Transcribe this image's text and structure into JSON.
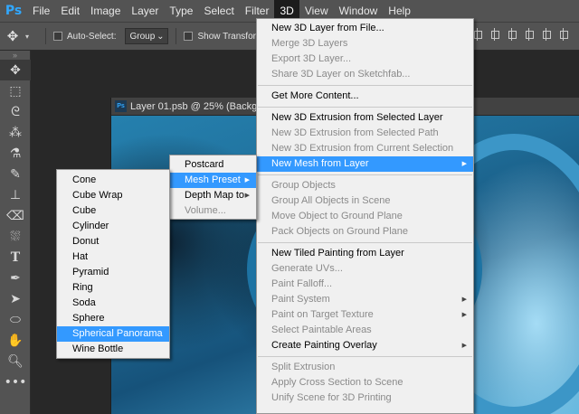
{
  "app": {
    "logo": "Ps",
    "menus": [
      "File",
      "Edit",
      "Image",
      "Layer",
      "Type",
      "Select",
      "Filter",
      "3D",
      "View",
      "Window",
      "Help"
    ],
    "active_menu": "3D"
  },
  "options_bar": {
    "move_icon": "move-icon",
    "auto_select_label": "Auto-Select:",
    "auto_select_value": "Group",
    "show_transform_label": "Show Transform"
  },
  "tools": [
    "move-tool",
    "marquee-tool",
    "lasso-tool",
    "magic-wand-tool",
    "eyedropper-tool",
    "brush-tool",
    "stamp-tool",
    "eraser-tool",
    "paint-bucket-tool",
    "type-tool",
    "pen-tool",
    "path-select-tool",
    "shape-tool",
    "hand-tool",
    "zoom-tool",
    "more-tools"
  ],
  "document": {
    "title": "Layer 01.psb @ 25% (Backgro"
  },
  "menu_3d": {
    "items": [
      {
        "label": "New 3D Layer from File...",
        "enabled": true
      },
      {
        "label": "Merge 3D Layers",
        "enabled": false
      },
      {
        "label": "Export 3D Layer...",
        "enabled": false
      },
      {
        "label": "Share 3D Layer on Sketchfab...",
        "enabled": false
      },
      {
        "separator": true
      },
      {
        "label": "Get More Content...",
        "enabled": true
      },
      {
        "separator": true
      },
      {
        "label": "New 3D Extrusion from Selected Layer",
        "enabled": true
      },
      {
        "label": "New 3D Extrusion from Selected Path",
        "enabled": false
      },
      {
        "label": "New 3D Extrusion from Current Selection",
        "enabled": false
      },
      {
        "label": "New Mesh from Layer",
        "enabled": true,
        "submenu": true,
        "highlighted": true
      },
      {
        "separator": true
      },
      {
        "label": "Group Objects",
        "enabled": false
      },
      {
        "label": "Group All Objects in Scene",
        "enabled": false
      },
      {
        "label": "Move Object to Ground Plane",
        "enabled": false
      },
      {
        "label": "Pack Objects on Ground Plane",
        "enabled": false
      },
      {
        "separator": true
      },
      {
        "label": "New Tiled Painting from Layer",
        "enabled": true
      },
      {
        "label": "Generate UVs...",
        "enabled": false
      },
      {
        "label": "Paint Falloff...",
        "enabled": false
      },
      {
        "label": "Paint System",
        "enabled": false,
        "submenu": true
      },
      {
        "label": "Paint on Target Texture",
        "enabled": false,
        "submenu": true
      },
      {
        "label": "Select Paintable Areas",
        "enabled": false
      },
      {
        "label": "Create Painting Overlay",
        "enabled": true,
        "submenu": true
      },
      {
        "separator": true
      },
      {
        "label": "Split Extrusion",
        "enabled": false
      },
      {
        "label": "Apply Cross Section to Scene",
        "enabled": false
      },
      {
        "label": "Unify Scene for 3D Printing",
        "enabled": false
      }
    ]
  },
  "menu_new_mesh": {
    "items": [
      {
        "label": "Postcard",
        "enabled": true
      },
      {
        "label": "Mesh Preset",
        "enabled": true,
        "submenu": true,
        "highlighted": true
      },
      {
        "label": "Depth Map to",
        "enabled": true,
        "submenu": true
      },
      {
        "label": "Volume...",
        "enabled": false
      }
    ]
  },
  "menu_mesh_preset": {
    "items": [
      {
        "label": "Cone",
        "enabled": true
      },
      {
        "label": "Cube Wrap",
        "enabled": true
      },
      {
        "label": "Cube",
        "enabled": true
      },
      {
        "label": "Cylinder",
        "enabled": true
      },
      {
        "label": "Donut",
        "enabled": true
      },
      {
        "label": "Hat",
        "enabled": true
      },
      {
        "label": "Pyramid",
        "enabled": true
      },
      {
        "label": "Ring",
        "enabled": true
      },
      {
        "label": "Soda",
        "enabled": true
      },
      {
        "label": "Sphere",
        "enabled": true
      },
      {
        "label": "Spherical Panorama",
        "enabled": true,
        "highlighted": true
      },
      {
        "label": "Wine Bottle",
        "enabled": true
      }
    ]
  },
  "colors": {
    "highlight": "#3399ff",
    "menu_bg": "#f0f0f0",
    "chrome": "#535353"
  }
}
